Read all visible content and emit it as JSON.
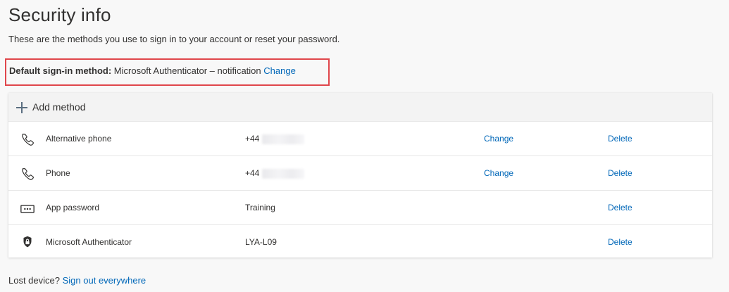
{
  "page": {
    "title": "Security info",
    "subtitle": "These are the methods you use to sign in to your account or reset your password."
  },
  "default_method": {
    "label": "Default sign-in method:",
    "value": "Microsoft Authenticator – notification",
    "change_label": "Change"
  },
  "methods_card": {
    "add_label": "Add method",
    "rows": [
      {
        "icon": "phone-icon",
        "name": "Alternative phone",
        "value": "+44",
        "value_redacted": true,
        "change_label": "Change",
        "delete_label": "Delete"
      },
      {
        "icon": "phone-icon",
        "name": "Phone",
        "value": "+44",
        "value_redacted": true,
        "change_label": "Change",
        "delete_label": "Delete"
      },
      {
        "icon": "password-icon",
        "name": "App password",
        "value": "Training",
        "value_redacted": false,
        "change_label": "",
        "delete_label": "Delete"
      },
      {
        "icon": "authenticator-lock-icon",
        "name": "Microsoft Authenticator",
        "value": "LYA-L09",
        "value_redacted": false,
        "change_label": "",
        "delete_label": "Delete"
      }
    ]
  },
  "footer": {
    "prefix": "Lost device?",
    "link_label": "Sign out everywhere"
  },
  "colors": {
    "link": "#0067b8",
    "highlight_border": "#e0464b",
    "background": "#f8f8f8"
  }
}
